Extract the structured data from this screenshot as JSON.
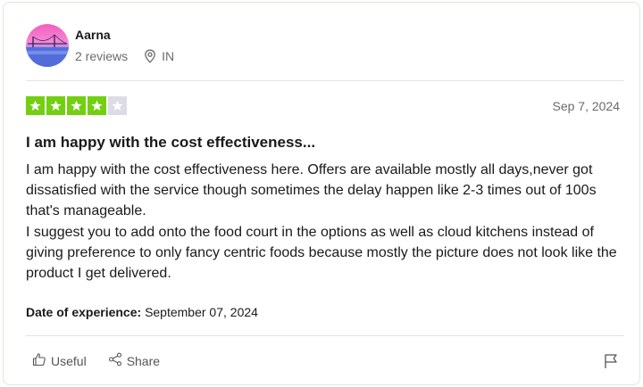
{
  "consumer": {
    "name": "Aarna",
    "reviews": "2 reviews",
    "country": "IN"
  },
  "review": {
    "rating": 4,
    "rating_max": 5,
    "date": "Sep 7, 2024",
    "title": "I am happy with the cost effectiveness...",
    "body_lines": [
      "I am happy with the cost effectiveness here. Offers are available mostly all days,never got dissatisfied with the service though sometimes the delay happen like 2-3 times out of 100s that's manageable.",
      "I suggest you to add onto the food court in the options as well as cloud kitchens instead of giving preference to only fancy centric foods because mostly the picture does not look like the product I get delivered."
    ],
    "experience_label": "Date of experience:",
    "experience_date": "September 07, 2024"
  },
  "actions": {
    "useful_label": "Useful",
    "share_label": "Share"
  },
  "colors": {
    "star_filled": "#73cf11",
    "star_empty": "#dcdce6",
    "text_muted": "#6b6b6b",
    "divider": "#e5e5dd"
  },
  "icons": {
    "location": "location-pin-icon",
    "useful": "thumbs-up-icon",
    "share": "share-icon",
    "flag": "flag-icon"
  }
}
